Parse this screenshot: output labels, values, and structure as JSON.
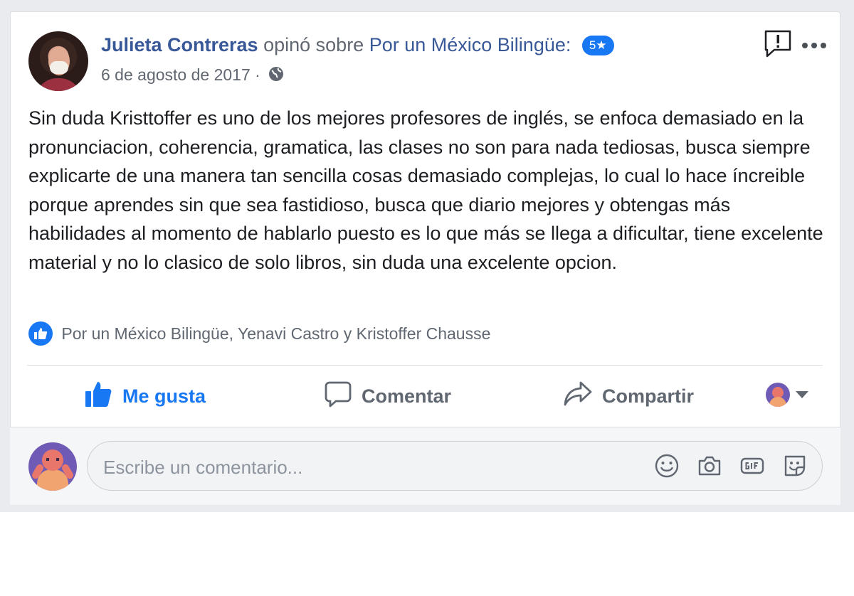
{
  "review": {
    "author": "Julieta Contreras",
    "verb": "opinó sobre",
    "page": "Por un México Bilingüe:",
    "rating_badge": "5★",
    "date": "6 de agosto de 2017 ·",
    "privacy_icon": "globe-icon",
    "text": "Sin duda Kristtoffer es uno de los mejores profesores de inglés, se enfoca demasiado en la pronunciacion, coherencia, gramatica, las clases no son para nada tediosas, busca siempre explicarte de una manera tan sencilla cosas demasiado complejas, lo cual lo hace íncreible porque aprendes sin que sea fastidioso, busca que diario mejores y obtengas más habilidades al momento de hablarlo puesto es lo que más se llega a dificultar, tiene excelente material y no lo clasico de solo libros, sin duda una excelente opcion.",
    "reactions_text": "Por un México Bilingüe, Yenavi Castro y Kristoffer Chausse"
  },
  "actions": {
    "like": "Me gusta",
    "comment": "Comentar",
    "share": "Compartir"
  },
  "comment_box": {
    "placeholder": "Escribe un comentario...",
    "icons": [
      "emoji-icon",
      "camera-icon",
      "gif-icon",
      "sticker-icon"
    ]
  },
  "colors": {
    "link": "#385898",
    "accent": "#1877f2",
    "text": "#1c1e21",
    "muted": "#606770"
  }
}
